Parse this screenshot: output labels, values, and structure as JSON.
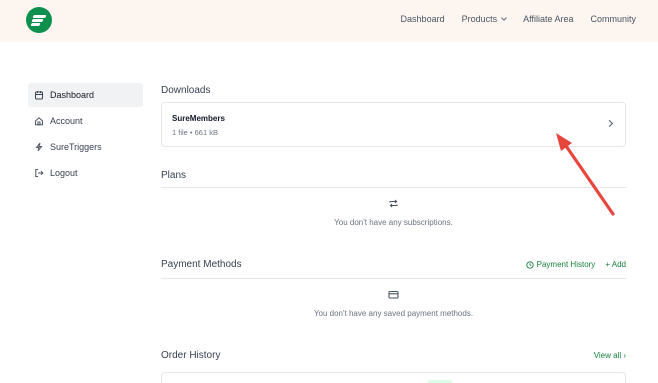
{
  "nav": {
    "items": [
      "Dashboard",
      "Products",
      "Affiliate Area",
      "Community"
    ]
  },
  "sidebar": {
    "items": [
      {
        "label": "Dashboard",
        "icon": "calendar-icon",
        "active": true
      },
      {
        "label": "Account",
        "icon": "home-icon"
      },
      {
        "label": "SureTriggers",
        "icon": "bolt-icon"
      },
      {
        "label": "Logout",
        "icon": "logout-icon"
      }
    ]
  },
  "downloads": {
    "title": "Downloads",
    "item_name": "SureMembers",
    "item_meta": "1 file • 661 kB"
  },
  "plans": {
    "title": "Plans",
    "empty_text": "You don't have any subscriptions."
  },
  "payment": {
    "title": "Payment Methods",
    "history_label": "Payment History",
    "add_label": "+ Add",
    "empty_text": "You don't have any saved payment methods."
  },
  "orders": {
    "title": "Order History",
    "view_all_label": "View all ›"
  },
  "colors": {
    "brand": "#0e8f4d",
    "accent_green": "#15803d",
    "annotation_arrow": "#e8453c"
  }
}
